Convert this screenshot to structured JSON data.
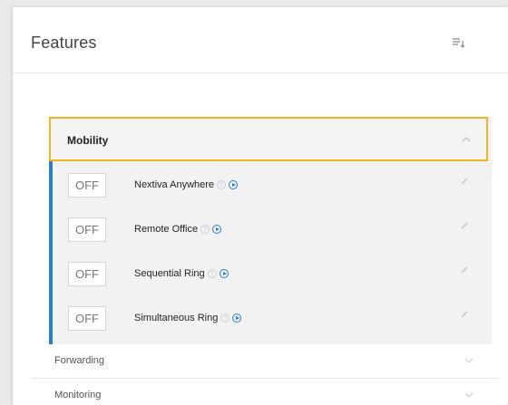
{
  "panel": {
    "title": "Features",
    "sort_icon": "sort-list-icon"
  },
  "mobility": {
    "title": "Mobility",
    "expanded": true,
    "items": [
      {
        "toggle": "OFF",
        "name": "Nextiva Anywhere"
      },
      {
        "toggle": "OFF",
        "name": "Remote Office"
      },
      {
        "toggle": "OFF",
        "name": "Sequential Ring"
      },
      {
        "toggle": "OFF",
        "name": "Simultaneous Ring"
      }
    ]
  },
  "sections": [
    {
      "title": "Forwarding",
      "expanded": false
    },
    {
      "title": "Monitoring",
      "expanded": false
    }
  ],
  "colors": {
    "accent_blue": "#2d7fc1",
    "focus_outline": "#f2b321",
    "section_bg": "#f2f2f2"
  }
}
